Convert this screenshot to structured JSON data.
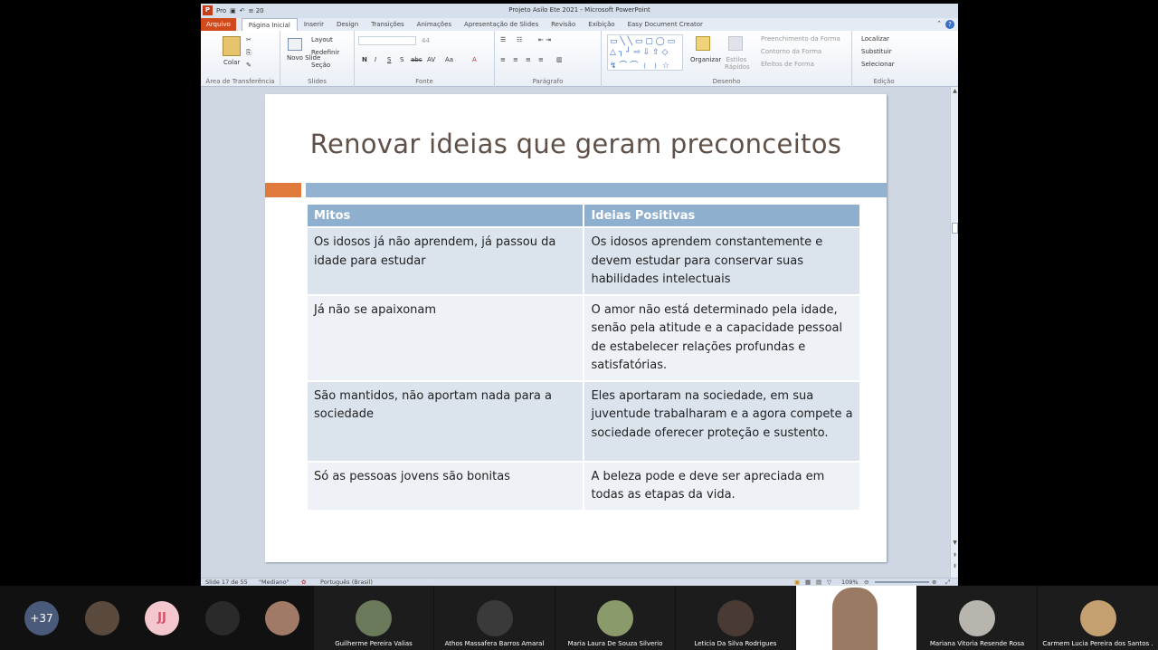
{
  "window": {
    "title": "Projeto Asilo Ete 2021 - Microsoft PowerPoint",
    "qat_label": "Pro",
    "qat_counter": "≡ 20"
  },
  "tabs": {
    "file": "Arquivo",
    "items": [
      "Página Inicial",
      "Inserir",
      "Design",
      "Transições",
      "Animações",
      "Apresentação de Slides",
      "Revisão",
      "Exibição",
      "Easy Document Creator"
    ]
  },
  "ribbon": {
    "clipboard": {
      "label": "Área de Transferência",
      "paste": "Colar"
    },
    "slides": {
      "label": "Slides",
      "new_slide": "Novo Slide",
      "layout": "Layout",
      "reset": "Redefinir",
      "section": "Seção"
    },
    "font": {
      "label": "Fonte",
      "size": "44",
      "bold": "N",
      "italic": "I",
      "underline": "S",
      "shadow": "S",
      "strike": "abc",
      "spacing": "AV",
      "case": "Aa",
      "color": "A"
    },
    "paragraph": {
      "label": "Parágrafo"
    },
    "drawing": {
      "label": "Desenho",
      "arrange": "Organizar",
      "quick_styles": "Estilos Rápidos",
      "fill": "Preenchimento da Forma",
      "outline": "Contorno da Forma",
      "effects": "Efeitos de Forma"
    },
    "editing": {
      "label": "Edição",
      "find": "Localizar",
      "replace": "Substituir",
      "select": "Selecionar"
    }
  },
  "slide": {
    "title": "Renovar ideias que geram preconceitos",
    "table": {
      "headers": [
        "Mitos",
        "Ideias Positivas"
      ],
      "rows": [
        [
          "Os idosos já não aprendem, já passou da idade para estudar",
          "Os idosos aprendem constantemente e devem estudar para conservar suas habilidades intelectuais"
        ],
        [
          "Já não se apaixonam",
          "O amor não está determinado pela idade, senão pela atitude e a capacidade pessoal de estabelecer relações profundas e satisfatórias."
        ],
        [
          "São mantidos, não aportam nada para a sociedade",
          "Eles aportaram na sociedade, em sua juventude trabalharam e a agora compete a sociedade oferecer proteção e sustento."
        ],
        [
          "Só as pessoas jovens são bonitas",
          "A beleza pode e deve ser apreciada em todas as etapas da vida."
        ]
      ]
    }
  },
  "status": {
    "slide_of": "Slide 17 de 55",
    "theme": "\"Mediano\"",
    "language": "Português (Brasil)",
    "zoom": "109%"
  },
  "meeting": {
    "more_count": "+37",
    "initials": "JJ",
    "participants": [
      "Guilherme Pereira Valias",
      "Athos Massafera Barros Amaral",
      "Maria Laura De Souza Silverio",
      "Leticia Da Silva Rodrigues",
      "Mariana Vitoria Resende Rosa",
      "Carmem Lucia Pereira dos Santos ."
    ],
    "colors": {
      "more_bubble": "#4a5a7a",
      "initials_bubble": "#f4c7cf",
      "active_speaker": "#ffffff"
    }
  }
}
